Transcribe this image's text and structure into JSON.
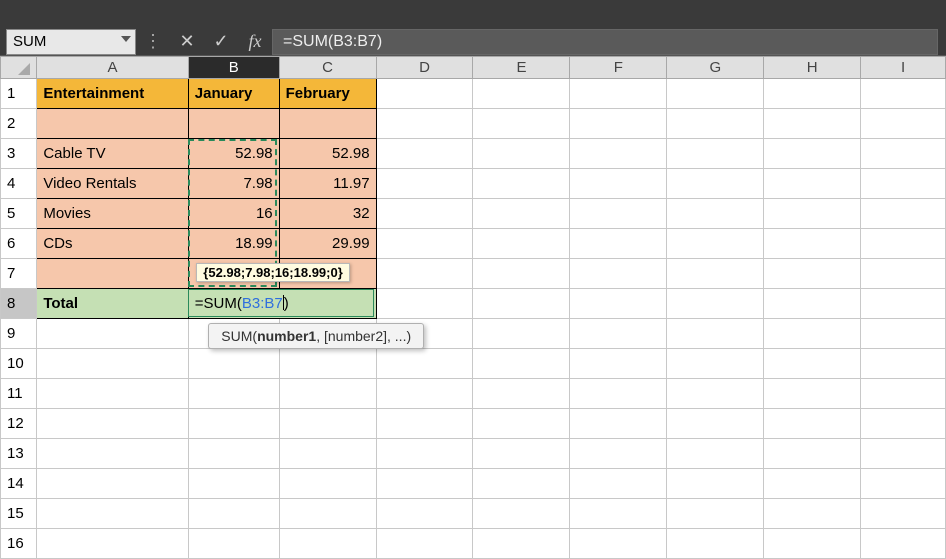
{
  "name_box": "SUM",
  "formula_bar": "=SUM(B3:B7)",
  "columns": [
    "A",
    "B",
    "C",
    "D",
    "E",
    "F",
    "G",
    "H",
    "I"
  ],
  "row_count": 16,
  "headers": {
    "A": "Entertainment",
    "B": "January",
    "C": "February"
  },
  "rows": [
    {
      "label": "Cable TV",
      "jan": "52.98",
      "feb": "52.98"
    },
    {
      "label": "Video Rentals",
      "jan": "7.98",
      "feb": "11.97"
    },
    {
      "label": "Movies",
      "jan": "16",
      "feb": "32"
    },
    {
      "label": "CDs",
      "jan": "18.99",
      "feb": "29.99"
    }
  ],
  "total_label": "Total",
  "edit_cell": {
    "prefix": "=SUM(",
    "ref": "B3:B7",
    "suffix": ")"
  },
  "value_hint": "{52.98;7.98;16;18.99;0}",
  "fn_tooltip": {
    "name": "SUM",
    "arg_bold": "number1",
    "rest": ", [number2], ...)"
  },
  "chart_data": {
    "type": "table",
    "title": "Entertainment",
    "categories": [
      "January",
      "February"
    ],
    "series": [
      {
        "name": "Cable TV",
        "values": [
          52.98,
          52.98
        ]
      },
      {
        "name": "Video Rentals",
        "values": [
          7.98,
          11.97
        ]
      },
      {
        "name": "Movies",
        "values": [
          16,
          32
        ]
      },
      {
        "name": "CDs",
        "values": [
          18.99,
          29.99
        ]
      }
    ]
  }
}
